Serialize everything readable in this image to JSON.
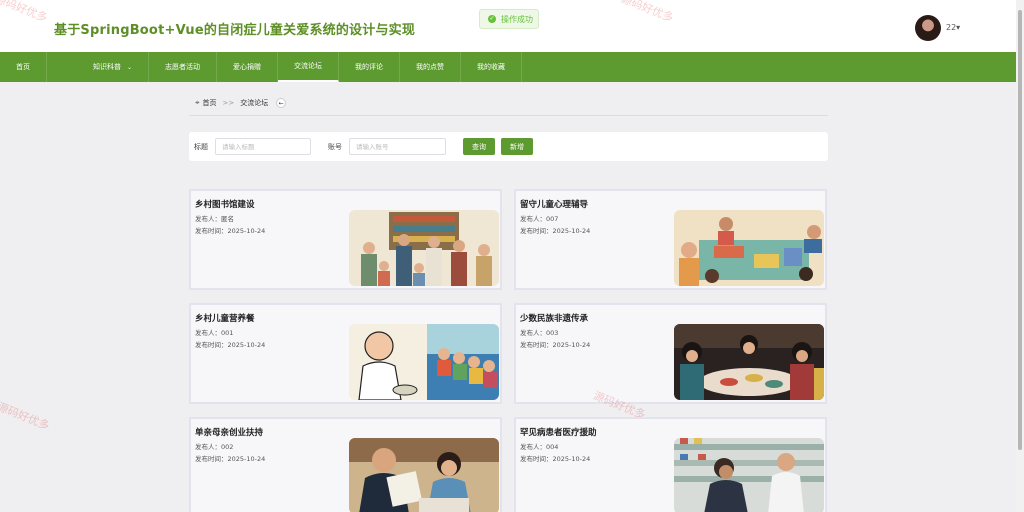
{
  "header": {
    "title": "基于SpringBoot+Vue的自闭症儿童关爱系统的设计与实现",
    "toast": "操作成功",
    "username": "22▾"
  },
  "nav": [
    {
      "label": "首页"
    },
    {
      "label": "知识科普",
      "caret": "⌄"
    },
    {
      "label": "志愿者活动"
    },
    {
      "label": "爱心捐赠"
    },
    {
      "label": "交流论坛"
    },
    {
      "label": "我的评论"
    },
    {
      "label": "我的点赞"
    },
    {
      "label": "我的收藏"
    }
  ],
  "breadcrumb": {
    "home": "首页",
    "sep": ">>",
    "current": "交流论坛",
    "back": "←"
  },
  "search": {
    "title_label": "标题",
    "title_placeholder": "请输入标题",
    "account_label": "账号",
    "account_placeholder": "请输入账号",
    "query_btn": "查询",
    "add_btn": "新增"
  },
  "posts": [
    {
      "title": "乡村图书馆建设",
      "author": "发布人：匿名",
      "date": "发布时间：2025-10-24"
    },
    {
      "title": "留守儿童心理辅导",
      "author": "发布人：007",
      "date": "发布时间：2025-10-24"
    },
    {
      "title": "乡村儿童营养餐",
      "author": "发布人：001",
      "date": "发布时间：2025-10-24"
    },
    {
      "title": "少数民族非遗传承",
      "author": "发布人：003",
      "date": "发布时间：2025-10-24"
    },
    {
      "title": "单亲母亲创业扶持",
      "author": "发布人：002",
      "date": "发布时间：2025-10-24"
    },
    {
      "title": "罕见病患者医疗援助",
      "author": "发布人：004",
      "date": "发布时间：2025-10-24"
    }
  ],
  "watermark": "源码好优多",
  "colors": {
    "primary": "#5d9a2f",
    "title": "#5d8f26",
    "success": "#67c23a"
  }
}
